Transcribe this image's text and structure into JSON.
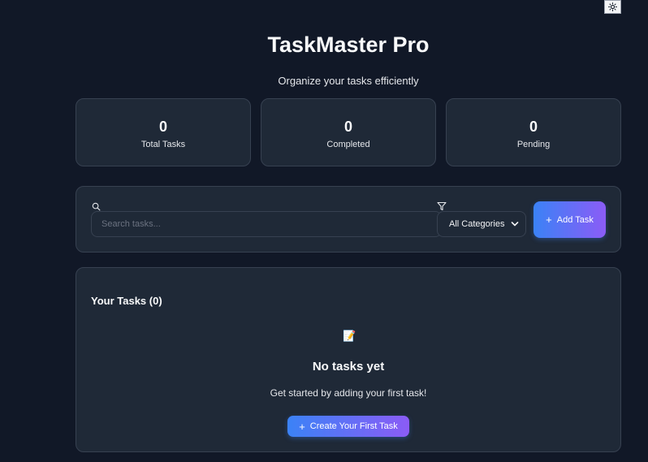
{
  "theme_toggle": {
    "icon": "sun-icon"
  },
  "header": {
    "title": "TaskMaster Pro",
    "subtitle": "Organize your tasks efficiently"
  },
  "stats": [
    {
      "value": "0",
      "label": "Total Tasks"
    },
    {
      "value": "0",
      "label": "Completed"
    },
    {
      "value": "0",
      "label": "Pending"
    }
  ],
  "toolbar": {
    "search_icon": "search-icon",
    "search_placeholder": "Search tasks...",
    "search_value": "",
    "filter_icon": "filter-icon",
    "category_selected": "All Categories",
    "add_label": "Add Task"
  },
  "tasks": {
    "heading": "Your Tasks (0)",
    "empty_icon": "memo-icon",
    "empty_glyph": "📝",
    "empty_title": "No tasks yet",
    "empty_text": "Get started by adding your first task!",
    "create_label": "Create Your First Task"
  },
  "colors": {
    "background": "#111827",
    "card": "#1f2937",
    "border": "#374151",
    "accent_start": "#3b82f6",
    "accent_end": "#8b5cf6"
  }
}
